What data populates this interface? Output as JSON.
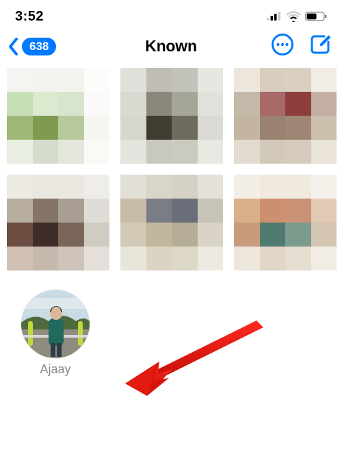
{
  "status": {
    "time": "3:52"
  },
  "nav": {
    "back_badge_count": "638",
    "title": "Known"
  },
  "contacts": {
    "first": {
      "name": "Ajaay"
    }
  },
  "accent_color": "#0079ff"
}
